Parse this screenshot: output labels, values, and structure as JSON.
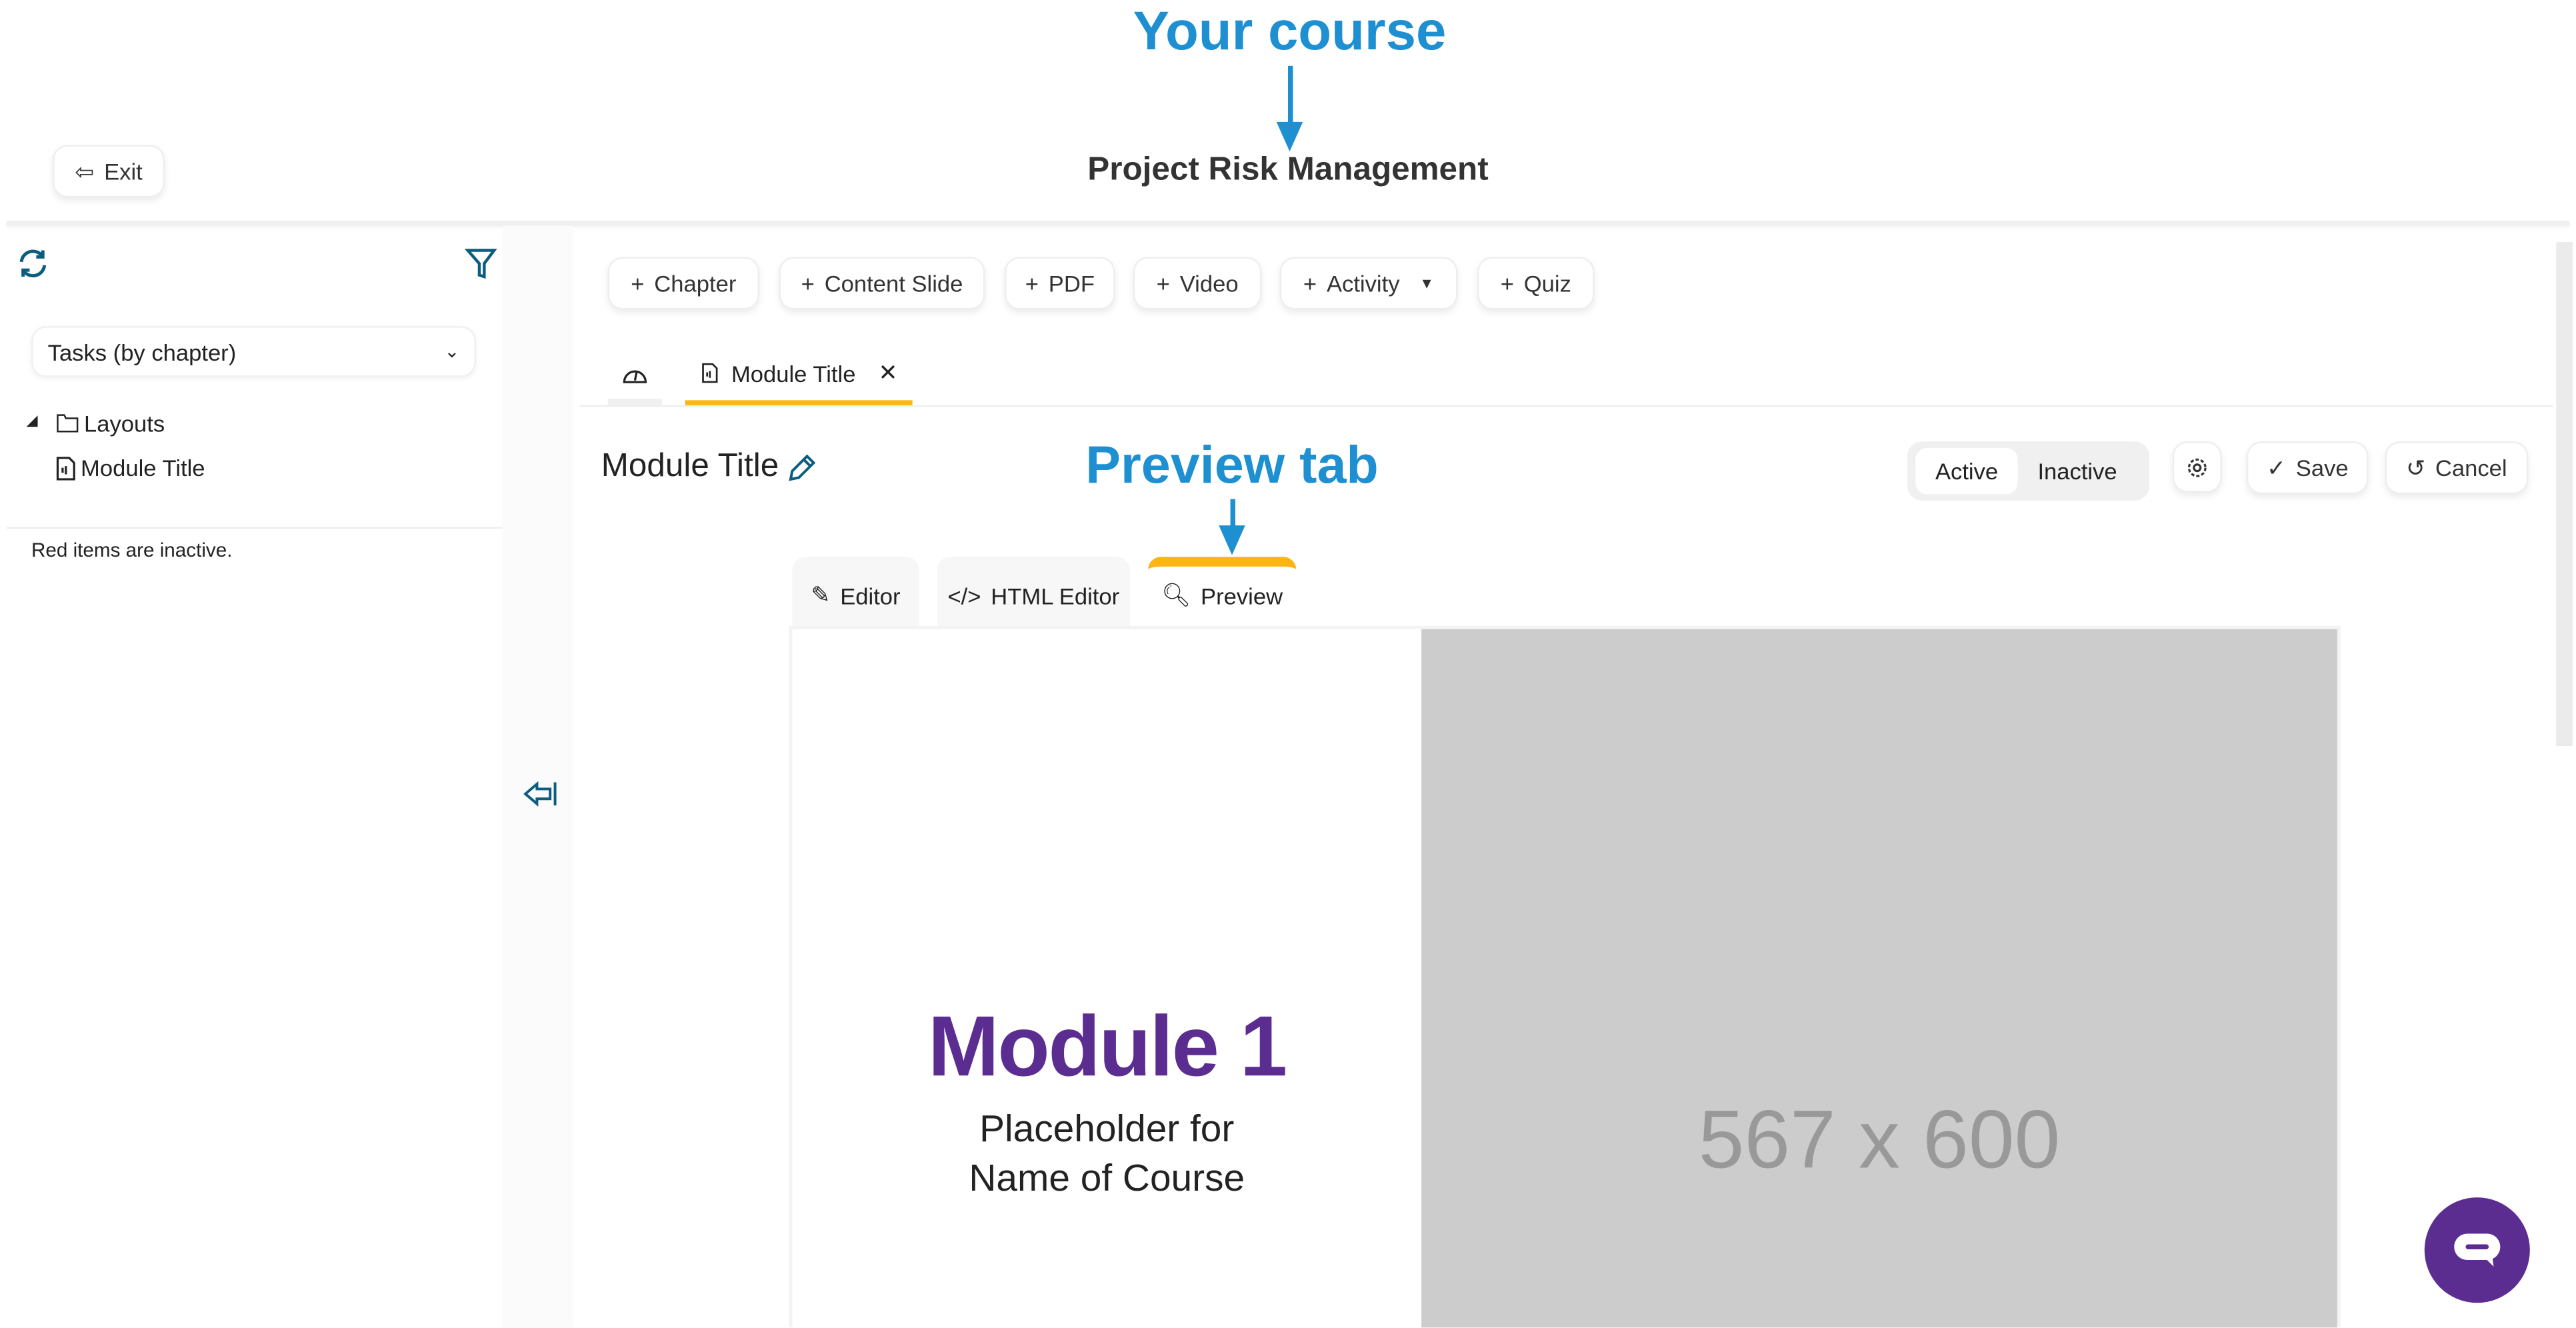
{
  "annotations": {
    "course": "Your course",
    "preview": "Preview tab",
    "color": "#1e8fd0"
  },
  "header": {
    "exit_label": "Exit",
    "course_title": "Project Risk Management"
  },
  "sidebar": {
    "select_value": "Tasks (by chapter)",
    "tree": [
      {
        "label": "Layouts",
        "icon": "folder-icon"
      },
      {
        "label": "Module Title",
        "icon": "file-audio-icon"
      }
    ],
    "note": "Red items are inactive."
  },
  "toolbar": {
    "buttons": [
      "Chapter",
      "Content Slide",
      "PDF",
      "Video",
      "Activity",
      "Quiz"
    ]
  },
  "tabs": {
    "open_tab": "Module Title"
  },
  "page": {
    "title": "Module Title",
    "status_options": [
      "Active",
      "Inactive"
    ],
    "status_selected": "Active",
    "save": "Save",
    "cancel": "Cancel"
  },
  "editor_tabs": {
    "items": [
      "Editor",
      "HTML Editor",
      "Preview"
    ],
    "active": "Preview"
  },
  "preview": {
    "heading": "Module 1",
    "line1": "Placeholder for",
    "line2": "Name of Course",
    "image_placeholder": "567 x 600",
    "heading_color": "#5c2d91"
  },
  "colors": {
    "accent": "#fdb515",
    "icon": "#0b5c7f",
    "chat": "#5b2d90"
  }
}
